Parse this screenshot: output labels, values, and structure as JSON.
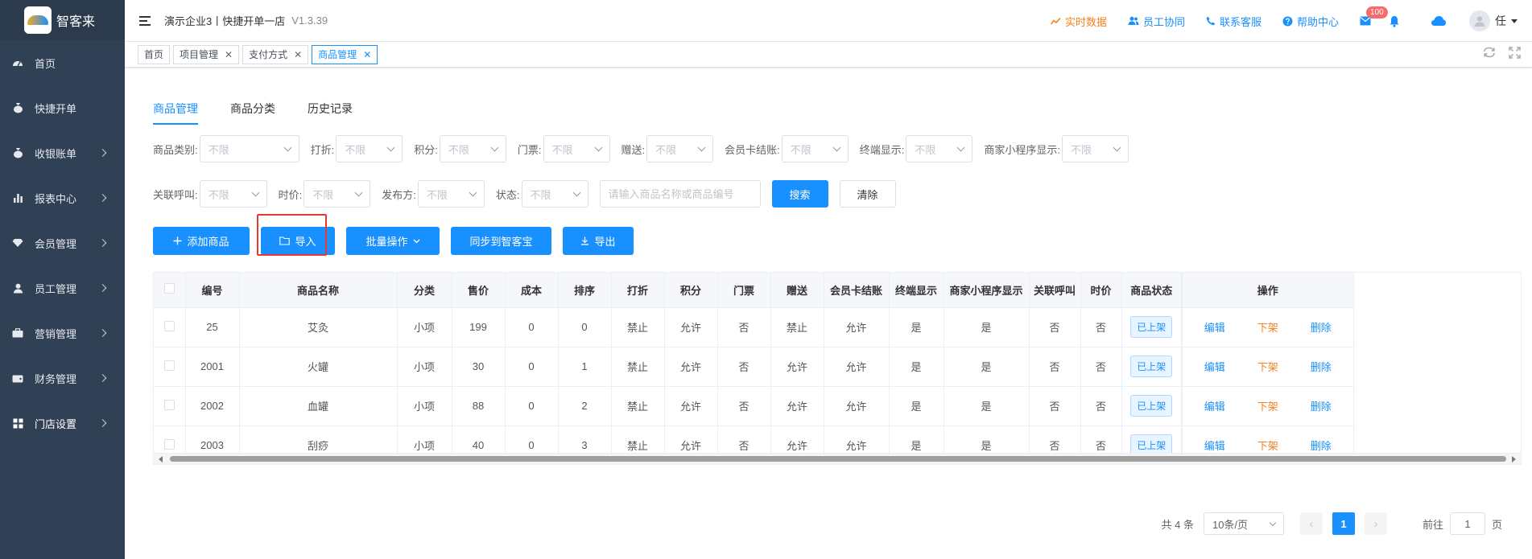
{
  "app": {
    "logo_text": "智客来",
    "logo_badge_text": "智客来",
    "store_name": "演示企业3丨快捷开单一店",
    "version": "V1.3.39"
  },
  "sidebar": {
    "items": [
      {
        "label": "首页",
        "icon": "dashboard-icon",
        "has_arrow": false
      },
      {
        "label": "快捷开单",
        "icon": "money-bag-icon",
        "has_arrow": false
      },
      {
        "label": "收银账单",
        "icon": "money-bag-icon",
        "has_arrow": true
      },
      {
        "label": "报表中心",
        "icon": "bar-chart-icon",
        "has_arrow": true
      },
      {
        "label": "会员管理",
        "icon": "diamond-icon",
        "has_arrow": true
      },
      {
        "label": "员工管理",
        "icon": "user-icon",
        "has_arrow": true
      },
      {
        "label": "营销管理",
        "icon": "briefcase-icon",
        "has_arrow": true
      },
      {
        "label": "财务管理",
        "icon": "wallet-icon",
        "has_arrow": true
      },
      {
        "label": "门店设置",
        "icon": "grid-icon",
        "has_arrow": true
      }
    ]
  },
  "header": {
    "links": [
      {
        "label": "实时数据",
        "icon": "trend-icon",
        "color": "#f5811b"
      },
      {
        "label": "员工协同",
        "icon": "users-icon",
        "color": "#1890ff"
      },
      {
        "label": "联系客服",
        "icon": "phone-icon",
        "color": "#1890ff"
      },
      {
        "label": "帮助中心",
        "icon": "help-icon",
        "color": "#1890ff"
      }
    ],
    "mail_badge": "100",
    "user_name": "任"
  },
  "tags": [
    {
      "label": "首页",
      "closable": false,
      "active": false
    },
    {
      "label": "项目管理",
      "closable": true,
      "active": false
    },
    {
      "label": "支付方式",
      "closable": true,
      "active": false
    },
    {
      "label": "商品管理",
      "closable": true,
      "active": true
    }
  ],
  "subtabs": [
    {
      "label": "商品管理",
      "active": true
    },
    {
      "label": "商品分类",
      "active": false
    },
    {
      "label": "历史记录",
      "active": false
    }
  ],
  "filters": {
    "row1": [
      {
        "label": "商品类别:",
        "value": "不限"
      },
      {
        "label": "打折:",
        "value": "不限"
      },
      {
        "label": "积分:",
        "value": "不限"
      },
      {
        "label": "门票:",
        "value": "不限"
      },
      {
        "label": "赠送:",
        "value": "不限"
      },
      {
        "label": "会员卡结账:",
        "value": "不限"
      },
      {
        "label": "终端显示:",
        "value": "不限"
      },
      {
        "label": "商家小程序显示:",
        "value": "不限"
      }
    ],
    "row2": [
      {
        "label": "关联呼叫:",
        "value": "不限"
      },
      {
        "label": "时价:",
        "value": "不限"
      },
      {
        "label": "发布方:",
        "value": "不限"
      },
      {
        "label": "状态:",
        "value": "不限"
      }
    ],
    "search_placeholder": "请输入商品名称或商品编号",
    "search_label": "搜索",
    "clear_label": "清除"
  },
  "actions": {
    "add": "添加商品",
    "import": "导入",
    "batch": "批量操作",
    "sync": "同步到智客宝",
    "export": "导出"
  },
  "table": {
    "columns": [
      "编号",
      "商品名称",
      "分类",
      "售价",
      "成本",
      "排序",
      "打折",
      "积分",
      "门票",
      "赠送",
      "会员卡结账",
      "终端显示",
      "商家小程序显示",
      "关联呼叫",
      "时价",
      "商品状态",
      "操作"
    ],
    "rows": [
      [
        "25",
        "艾灸",
        "小项",
        "199",
        "0",
        "0",
        "禁止",
        "允许",
        "否",
        "禁止",
        "允许",
        "是",
        "是",
        "否",
        "否",
        "已上架"
      ],
      [
        "2001",
        "火罐",
        "小项",
        "30",
        "0",
        "1",
        "禁止",
        "允许",
        "否",
        "允许",
        "允许",
        "是",
        "是",
        "否",
        "否",
        "已上架"
      ],
      [
        "2002",
        "血罐",
        "小项",
        "88",
        "0",
        "2",
        "禁止",
        "允许",
        "否",
        "允许",
        "允许",
        "是",
        "是",
        "否",
        "否",
        "已上架"
      ],
      [
        "2003",
        "刮痧",
        "小项",
        "40",
        "0",
        "3",
        "禁止",
        "允许",
        "否",
        "允许",
        "允许",
        "是",
        "是",
        "否",
        "否",
        "已上架"
      ]
    ],
    "ops": {
      "edit": "编辑",
      "offshelf": "下架",
      "delete": "删除"
    }
  },
  "pagination": {
    "total": "共 4 条",
    "page_size": "10条/页",
    "current": "1",
    "goto_prefix": "前往",
    "goto_value": "1",
    "goto_suffix": "页"
  },
  "colors": {
    "primary": "#1890ff",
    "sidebar_bg": "#304156",
    "warning": "#f5811b",
    "highlight": "#e53935"
  }
}
